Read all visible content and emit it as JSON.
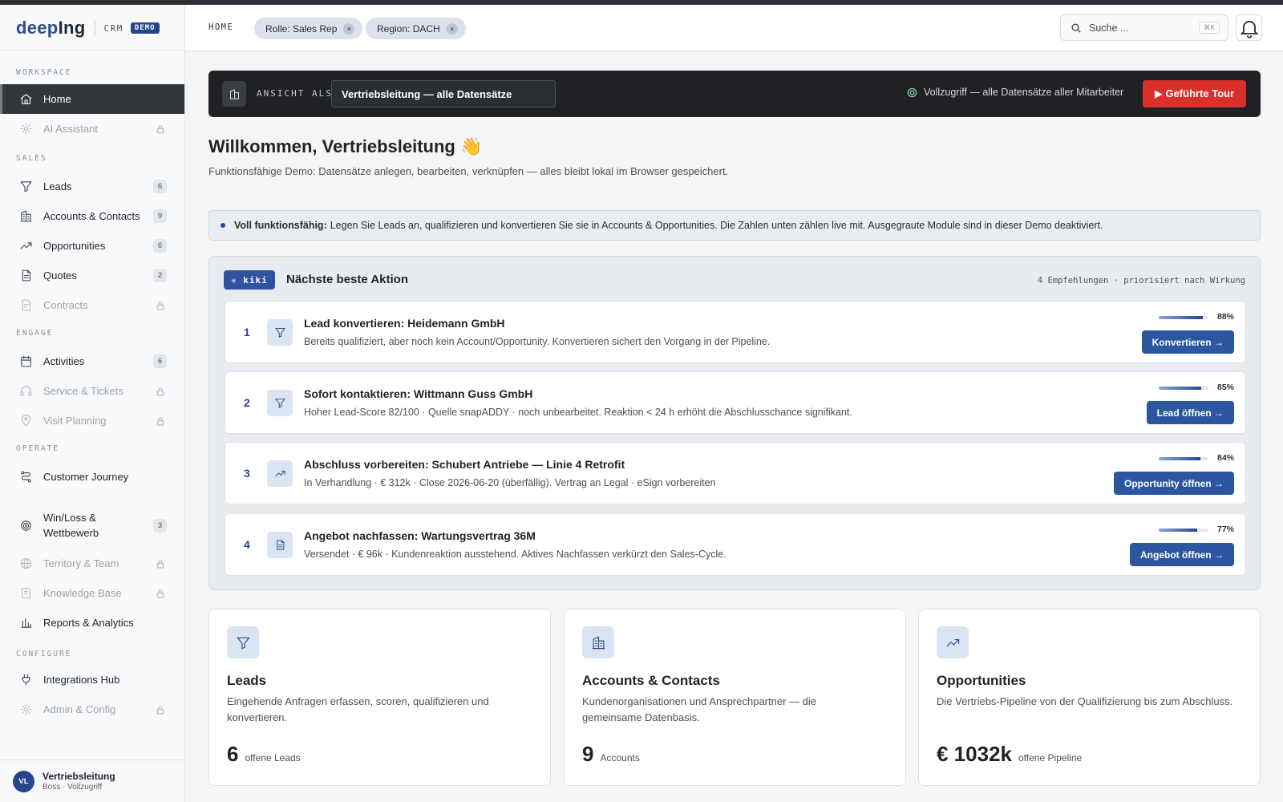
{
  "brand": {
    "logo_a": "deep",
    "logo_b": "Ing",
    "product": "CRM",
    "badge": "DEMO"
  },
  "sidebar": {
    "sections": {
      "workspace": "WORKSPACE",
      "sales": "SALES",
      "engage": "ENGAGE",
      "operate": "OPERATE",
      "configure": "CONFIGURE"
    },
    "items": [
      {
        "label": "Home",
        "icon": "home-icon",
        "active": true
      },
      {
        "label": "AI Assistant",
        "icon": "sparkle-icon",
        "locked": true
      },
      {
        "label": "Leads",
        "icon": "funnel-icon",
        "count": "6"
      },
      {
        "label": "Accounts & Contacts",
        "icon": "building-icon",
        "count": "9"
      },
      {
        "label": "Opportunities",
        "icon": "trend-up-icon",
        "count": "6"
      },
      {
        "label": "Quotes",
        "icon": "document-icon",
        "count": "2"
      },
      {
        "label": "Contracts",
        "icon": "contract-icon",
        "locked": true
      },
      {
        "label": "Activities",
        "icon": "calendar-icon",
        "count": "6"
      },
      {
        "label": "Service & Tickets",
        "icon": "headset-icon",
        "locked": true
      },
      {
        "label": "Visit Planning",
        "icon": "map-pin-icon",
        "locked": true
      },
      {
        "label": "Customer Journey",
        "icon": "route-icon"
      },
      {
        "label_line1": "Win/Loss &",
        "label_line2": "Wettbewerb",
        "icon": "target-icon",
        "count": "3"
      },
      {
        "label": "Territory & Team",
        "icon": "globe-icon",
        "locked": true
      },
      {
        "label": "Knowledge Base",
        "icon": "book-icon",
        "locked": true
      },
      {
        "label": "Reports & Analytics",
        "icon": "bar-chart-icon"
      },
      {
        "label": "Integrations Hub",
        "icon": "plug-icon"
      },
      {
        "label": "Admin & Config",
        "icon": "gear-icon",
        "locked": true
      }
    ],
    "user": {
      "initials": "VL",
      "name": "Vertriebsleitung",
      "sub": "Boss · Vollzugriff"
    }
  },
  "header": {
    "breadcrumb": "HOME",
    "chips": [
      {
        "label": "Rolle: Sales Rep"
      },
      {
        "label": "Region: DACH"
      }
    ],
    "search_placeholder": "Suche ...",
    "search_shortcut": "⌘K"
  },
  "viewbar": {
    "label": "ANSICHT ALS",
    "selected": "Vertriebsleitung — alle Datensätze",
    "access": "Vollzugriff — alle Datensätze aller Mitarbeiter",
    "tour_button": "▶ Geführte Tour"
  },
  "welcome": {
    "title": "Willkommen, Vertriebsleitung 👋",
    "subtitle": "Funktionsfähige Demo: Datensätze anlegen, bearbeiten, verknüpfen — alles bleibt lokal im Browser gespeichert."
  },
  "info": {
    "bold": "Voll funktionsfähig:",
    "text": "Legen Sie Leads an, qualifizieren und konvertieren Sie sie in Accounts & Opportunities. Die Zahlen unten zählen live mit. Ausgegraute Module sind in dieser Demo deaktiviert."
  },
  "nba": {
    "badge": "✳ kiki",
    "title": "Nächste beste Aktion",
    "meta": "4 Empfehlungen · priorisiert nach Wirkung",
    "items": [
      {
        "num": "1",
        "icon": "funnel-icon",
        "title": "Lead konvertieren: Heidemann GmbH",
        "desc": "Bereits qualifiziert, aber noch kein Account/Opportunity. Konvertieren sichert den Vorgang in der Pipeline.",
        "score": 88,
        "score_label": "88%",
        "action": "Konvertieren →"
      },
      {
        "num": "2",
        "icon": "funnel-icon",
        "title": "Sofort kontaktieren: Wittmann Guss GmbH",
        "desc": "Hoher Lead-Score 82/100 · Quelle snapADDY · noch unbearbeitet. Reaktion < 24 h erhöht die Abschlusschance signifikant.",
        "score": 85,
        "score_label": "85%",
        "action": "Lead öffnen →"
      },
      {
        "num": "3",
        "icon": "trend-up-icon",
        "title": "Abschluss vorbereiten: Schubert Antriebe — Linie 4 Retrofit",
        "desc": "In Verhandlung · € 312k · Close 2026-06-20 (überfällig). Vertrag an Legal · eSign vorbereiten",
        "score": 84,
        "score_label": "84%",
        "action": "Opportunity öffnen →"
      },
      {
        "num": "4",
        "icon": "document-icon",
        "title": "Angebot nachfassen: Wartungsvertrag 36M",
        "desc": "Versendet · € 96k · Kundenreaktion ausstehend. Aktives Nachfassen verkürzt den Sales-Cycle.",
        "score": 77,
        "score_label": "77%",
        "action": "Angebot öffnen →"
      }
    ]
  },
  "cards": [
    {
      "icon": "funnel-icon",
      "title": "Leads",
      "desc": "Eingehende Anfragen erfassen, scoren, qualifizieren und konvertieren.",
      "value": "6",
      "unit": "offene Leads"
    },
    {
      "icon": "building-icon",
      "title": "Accounts & Contacts",
      "desc": "Kundenorganisationen und Ansprechpartner — die gemeinsame Datenbasis.",
      "value": "9",
      "unit": "Accounts"
    },
    {
      "icon": "trend-up-icon",
      "title": "Opportunities",
      "desc": "Die Vertriebs-Pipeline von der Qualifizierung bis zum Abschluss.",
      "value": "€ 1032k",
      "unit": "offene Pipeline"
    }
  ],
  "colors": {
    "accent": "#25478a",
    "button": "#2c57a0",
    "tour": "#d9302c",
    "sidebar_active": "#33373c",
    "dark_bar": "#1f2124"
  }
}
